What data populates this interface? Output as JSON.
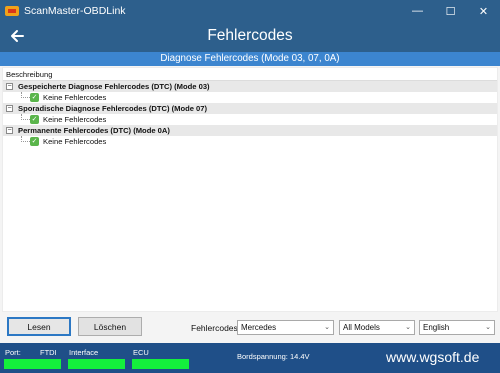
{
  "window": {
    "title": "ScanMaster-OBDLink",
    "minimize_glyph": "—",
    "maximize_glyph": "☐",
    "close_glyph": "✕"
  },
  "header": {
    "title": "Fehlercodes",
    "subtitle": "Diagnose Fehlercodes (Mode 03, 07, 0A)"
  },
  "tree": {
    "column_header": "Beschreibung",
    "groups": [
      {
        "label": "Gespeicherte Diagnose Fehlercodes (DTC) (Mode 03)",
        "expander": "−",
        "child": "Keine Fehlercodes"
      },
      {
        "label": "Sporadische Diagnose Fehlercodes (DTC) (Mode 07)",
        "expander": "−",
        "child": "Keine Fehlercodes"
      },
      {
        "label": "Permanente Fehlercodes (DTC) (Mode 0A)",
        "expander": "−",
        "child": "Keine Fehlercodes"
      }
    ],
    "ok_glyph": "✓"
  },
  "controls": {
    "read_label": "Lesen",
    "clear_label": "Löschen",
    "fehlercodes_label": "Fehlercodes",
    "make_value": "Mercedes",
    "model_value": "All Models",
    "language_value": "English",
    "caret_glyph": "⌄"
  },
  "status": {
    "port_label": "Port:",
    "ftdi_label": "FTDI",
    "interface_label": "Interface",
    "ecu_label": "ECU",
    "voltage_text": "Bordspannung: 14.4V",
    "website": "www.wgsoft.de",
    "led_color": "#14f03c"
  },
  "colors": {
    "titlebar": "#2d5f8c",
    "subheader": "#3c85cf",
    "statusbar": "#1f4f88"
  }
}
